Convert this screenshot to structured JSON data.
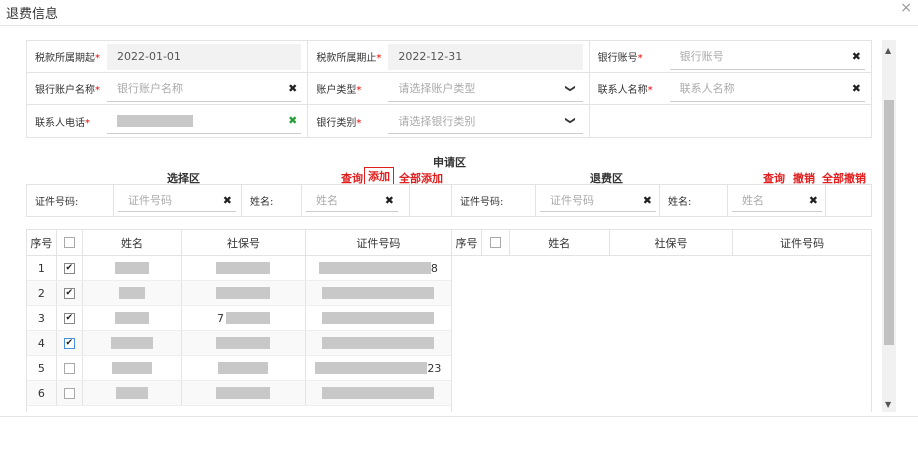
{
  "dialog": {
    "title": "退费信息",
    "close_glyph": "×"
  },
  "form": {
    "rows": [
      [
        {
          "label": "税款所属期起",
          "value": "2022-01-01",
          "kind": "readonly"
        },
        {
          "label": "税款所属期止",
          "value": "2022-12-31",
          "kind": "readonly"
        },
        {
          "label": "银行账号",
          "placeholder": "银行账号",
          "kind": "clear"
        }
      ],
      [
        {
          "label": "银行账户名称",
          "placeholder": "银行账户名称",
          "kind": "clear"
        },
        {
          "label": "账户类型",
          "placeholder": "请选择账户类型",
          "kind": "select"
        },
        {
          "label": "联系人名称",
          "placeholder": "联系人名称",
          "kind": "clear"
        }
      ],
      [
        {
          "label": "联系人电话",
          "value": "",
          "kind": "redacted"
        },
        {
          "label": "银行类别",
          "placeholder": "请选择银行类别",
          "kind": "select"
        },
        {
          "label": "",
          "kind": "empty"
        }
      ]
    ],
    "required_mark": "*",
    "clear_glyph": "✖",
    "select_glyph": "❯"
  },
  "sections": {
    "apply_title": "申请区",
    "select_title": "选择区",
    "refund_title": "退费区",
    "select_links": [
      "查询",
      "添加",
      "全部添加"
    ],
    "refund_links": [
      "查询",
      "撤销",
      "全部撤销"
    ]
  },
  "search": {
    "left": {
      "cert_label": "证件号码:",
      "cert_placeholder": "证件号码",
      "name_label": "姓名:",
      "name_placeholder": "姓名"
    },
    "right": {
      "cert_label": "证件号码:",
      "cert_placeholder": "证件号码",
      "name_label": "姓名:",
      "name_placeholder": "姓名"
    }
  },
  "left_table": {
    "headers": [
      "序号",
      "",
      "姓名",
      "社保号",
      "证件号码"
    ],
    "rows": [
      {
        "no": "1",
        "checked": true,
        "ssn_prefix": "",
        "cert_suffix": "8"
      },
      {
        "no": "2",
        "checked": true,
        "ssn_prefix": "",
        "cert_suffix": ""
      },
      {
        "no": "3",
        "checked": true,
        "ssn_prefix": "7",
        "cert_suffix": ""
      },
      {
        "no": "4",
        "checked": true,
        "ssn_prefix": "",
        "cert_suffix": ""
      },
      {
        "no": "5",
        "checked": false,
        "ssn_prefix": "",
        "cert_suffix": "23"
      },
      {
        "no": "6",
        "checked": false,
        "ssn_prefix": "",
        "cert_suffix": ""
      }
    ]
  },
  "right_table": {
    "headers": [
      "序号",
      "",
      "姓名",
      "社保号",
      "证件号码"
    ]
  }
}
